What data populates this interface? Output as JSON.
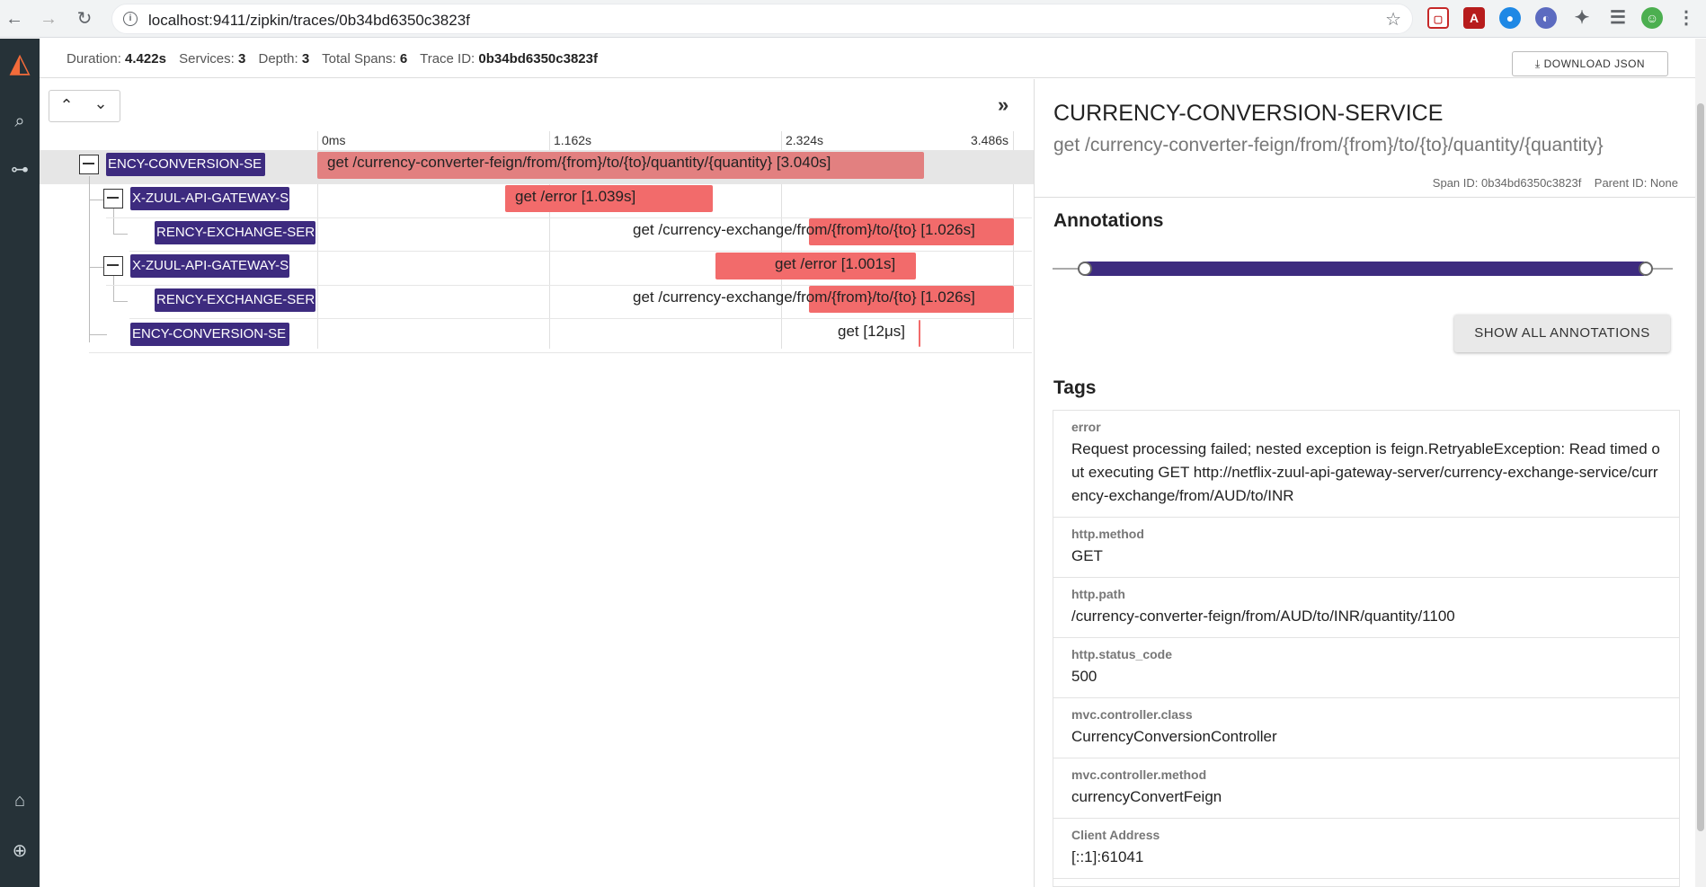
{
  "browser": {
    "url": "localhost:9411/zipkin/traces/0b34bd6350c3823f",
    "back_icon": "arrow-left",
    "forward_icon": "arrow-right",
    "reload_icon": "reload"
  },
  "summary": {
    "duration_label": "Duration:",
    "duration": "4.422s",
    "services_label": "Services:",
    "services": "3",
    "depth_label": "Depth:",
    "depth": "3",
    "total_spans_label": "Total Spans:",
    "total_spans": "6",
    "trace_id_label": "Trace ID:",
    "trace_id": "0b34bd6350c3823f",
    "download_label": "DOWNLOAD JSON"
  },
  "timeline": {
    "ticks": [
      "0ms",
      "1.162s",
      "2.324s",
      "3.486s"
    ],
    "spans": [
      {
        "service": "ENCY-CONVERSION-SE",
        "name": "get /currency-converter-feign/from/{from}/to/{to}/quantity/{quantity} [3.040s]"
      },
      {
        "service": "X-ZUUL-API-GATEWAY-S",
        "name": "get /error [1.039s]"
      },
      {
        "service": "RENCY-EXCHANGE-SER",
        "name": "get /currency-exchange/from/{from}/to/{to} [1.026s]"
      },
      {
        "service": "X-ZUUL-API-GATEWAY-S",
        "name": "get /error [1.001s]"
      },
      {
        "service": "RENCY-EXCHANGE-SER",
        "name": "get /currency-exchange/from/{from}/to/{to} [1.026s]"
      },
      {
        "service": "ENCY-CONVERSION-SE",
        "name": "get [12μs]"
      }
    ]
  },
  "detail": {
    "service_name": "CURRENCY-CONVERSION-SERVICE",
    "span_name": "get /currency-converter-feign/from/{from}/to/{to}/quantity/{quantity}",
    "span_id": "Span ID: 0b34bd6350c3823f",
    "parent_id": "Parent ID: None",
    "annotations_title": "Annotations",
    "show_all_label": "SHOW ALL ANNOTATIONS",
    "tags_title": "Tags",
    "tags": [
      {
        "key": "error",
        "value": "Request processing failed; nested exception is feign.RetryableException: Read timed out executing GET http://netflix-zuul-api-gateway-server/currency-exchange-service/currency-exchange/from/AUD/to/INR"
      },
      {
        "key": "http.method",
        "value": "GET"
      },
      {
        "key": "http.path",
        "value": "/currency-converter-feign/from/AUD/to/INR/quantity/1100"
      },
      {
        "key": "http.status_code",
        "value": "500"
      },
      {
        "key": "mvc.controller.class",
        "value": "CurrencyConversionController"
      },
      {
        "key": "mvc.controller.method",
        "value": "currencyConvertFeign"
      },
      {
        "key": "Client Address",
        "value": "[::1]:61041"
      }
    ]
  },
  "colors": {
    "service_badge": "#3d2b7f",
    "span_bar": "#f26b6b",
    "accent_logo": "#f26b3a"
  }
}
